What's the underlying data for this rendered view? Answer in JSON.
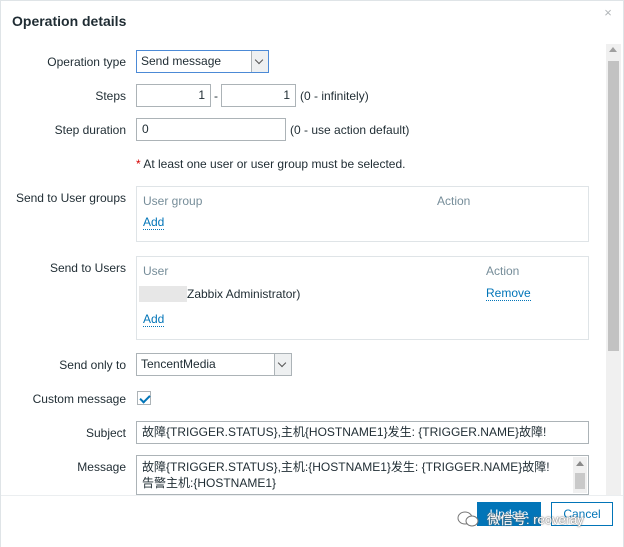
{
  "dialog": {
    "title": "Operation details",
    "close": "×"
  },
  "form": {
    "operation_type": {
      "label": "Operation type",
      "value": "Send message"
    },
    "steps": {
      "label": "Steps",
      "from": "1",
      "separator": "-",
      "to": "1",
      "hint": "(0 - infinitely)"
    },
    "step_duration": {
      "label": "Step duration",
      "value": "0",
      "hint": "(0 - use action default)"
    },
    "required_note": {
      "star": "*",
      "text": "At least one user or user group must be selected."
    },
    "user_groups": {
      "label": "Send to User groups",
      "col_group": "User group",
      "col_action": "Action",
      "add": "Add"
    },
    "users": {
      "label": "Send to Users",
      "col_user": "User",
      "col_action": "Action",
      "rows": [
        {
          "user": "Zabbix Administrator)",
          "action": "Remove"
        }
      ],
      "add": "Add"
    },
    "send_only_to": {
      "label": "Send only to",
      "value": "TencentMedia"
    },
    "custom_message": {
      "label": "Custom message",
      "checked": true
    },
    "subject": {
      "label": "Subject",
      "value": "故障{TRIGGER.STATUS},主机{HOSTNAME1}发生: {TRIGGER.NAME}故障!"
    },
    "message": {
      "label": "Message",
      "line1": "故障{TRIGGER.STATUS},主机:{HOSTNAME1}发生: {TRIGGER.NAME}故障!",
      "line2": "告警主机:{HOSTNAME1}"
    }
  },
  "footer": {
    "update": "Update",
    "cancel": "Cancel"
  },
  "watermark": {
    "text": "微信号: reoveray"
  }
}
